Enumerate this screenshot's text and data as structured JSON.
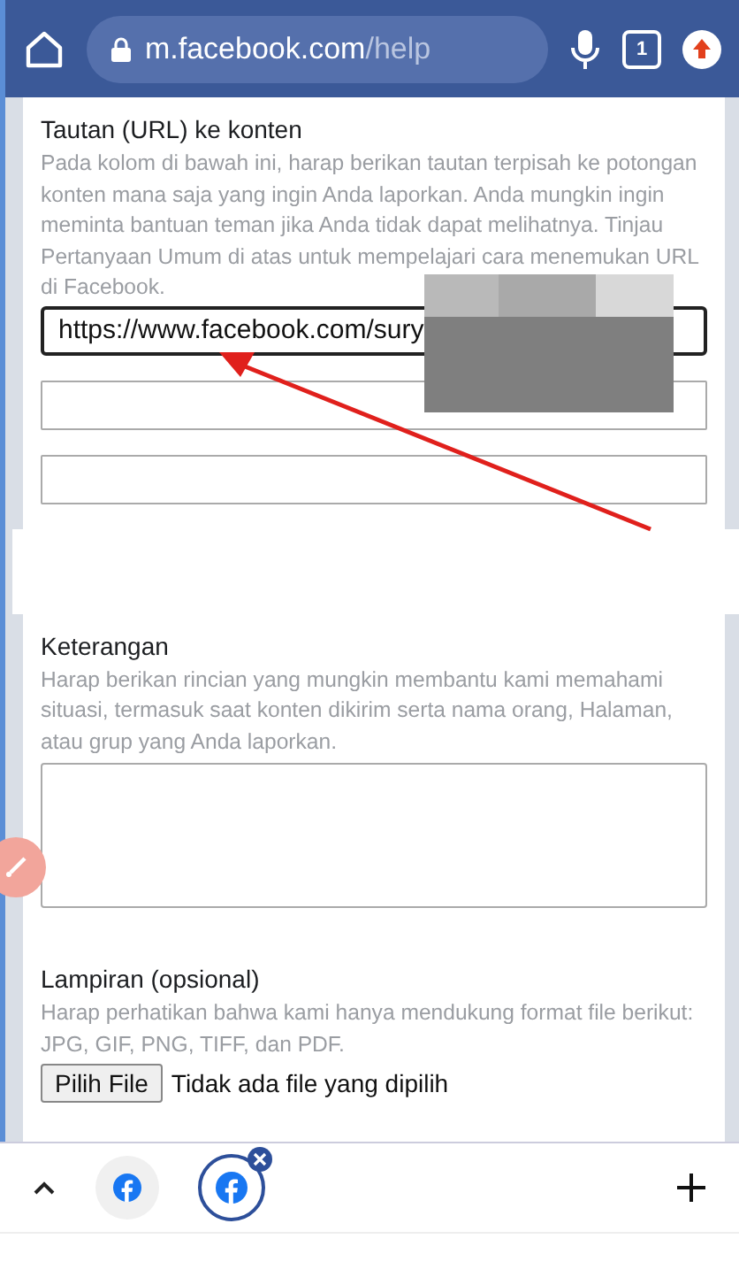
{
  "browser_bar": {
    "url_host": "m.facebook.com",
    "url_path": "/help",
    "tab_count": "1"
  },
  "sections": [
    {
      "kind": "links",
      "title": "Tautan (URL) ke konten",
      "description": "Pada kolom di bawah ini, harap berikan tautan terpisah ke potongan konten mana saja yang ingin Anda laporkan. Anda mungkin ingin meminta bantuan teman jika Anda tidak dapat melihatnya. Tinjau Pertanyaan Umum di atas untuk mempelajari cara menemukan URL di Facebook.",
      "fields": [
        {
          "value": "https://www.facebook.com/sury",
          "focused": true
        },
        {
          "focused": false
        },
        {
          "focused": false
        }
      ]
    },
    {
      "kind": "textarea",
      "title": "Keterangan",
      "description": "Harap berikan rincian yang mungkin membantu kami memahami situasi, termasuk saat konten dikirim serta nama orang, Halaman, atau grup yang Anda laporkan."
    },
    {
      "kind": "file",
      "title": "Lampiran (opsional)",
      "description": "Harap perhatikan bahwa kami hanya mendukung format file berikut: JPG, GIF, PNG, TIFF, dan PDF.",
      "button": "Pilih File",
      "status": "Tidak ada file yang dipilih"
    }
  ],
  "tab_strip": {
    "tabs": [
      {
        "selected": false
      },
      {
        "selected": true
      }
    ]
  }
}
